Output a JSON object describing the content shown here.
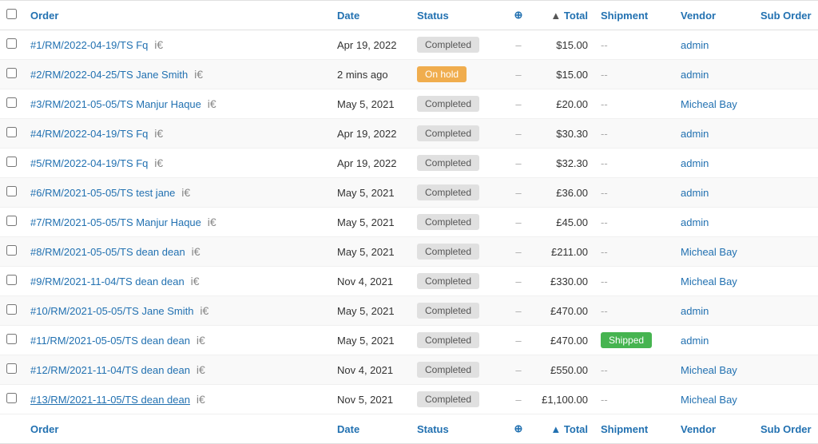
{
  "colors": {
    "link": "#2271b1",
    "completed_bg": "#e0e0e0",
    "completed_text": "#555",
    "onhold_bg": "#f0ad4e",
    "shipped_bg": "#46b450"
  },
  "header": {
    "columns": [
      {
        "id": "check",
        "label": ""
      },
      {
        "id": "order",
        "label": "Order",
        "sortable": true
      },
      {
        "id": "date",
        "label": "Date",
        "sortable": true
      },
      {
        "id": "status",
        "label": "Status",
        "sortable": false
      },
      {
        "id": "total_icon",
        "label": "⊕",
        "sortable": false
      },
      {
        "id": "total",
        "label": "Total",
        "sortable": true,
        "arrow": "▲"
      },
      {
        "id": "shipment",
        "label": "Shipment",
        "sortable": false
      },
      {
        "id": "vendor",
        "label": "Vendor",
        "sortable": false
      },
      {
        "id": "suborder",
        "label": "Sub Order",
        "sortable": false
      }
    ]
  },
  "rows": [
    {
      "id": 1,
      "order": "#1/RM/2022-04-19/TS Fq",
      "icon": "i€",
      "date": "Apr 19, 2022",
      "status": "Completed",
      "status_type": "completed",
      "total_dash": "–",
      "total": "$15.00",
      "shipment": "--",
      "vendor": "admin",
      "suborder": ""
    },
    {
      "id": 2,
      "order": "#2/RM/2022-04-25/TS Jane Smith",
      "icon": "i€",
      "date": "2 mins ago",
      "status": "On hold",
      "status_type": "onhold",
      "total_dash": "–",
      "total": "$15.00",
      "shipment": "--",
      "vendor": "admin",
      "suborder": ""
    },
    {
      "id": 3,
      "order": "#3/RM/2021-05-05/TS Manjur Haque",
      "icon": "i€",
      "date": "May 5, 2021",
      "status": "Completed",
      "status_type": "completed",
      "total_dash": "–",
      "total": "£20.00",
      "shipment": "--",
      "vendor": "Micheal Bay",
      "suborder": ""
    },
    {
      "id": 4,
      "order": "#4/RM/2022-04-19/TS Fq",
      "icon": "i€",
      "date": "Apr 19, 2022",
      "status": "Completed",
      "status_type": "completed",
      "total_dash": "–",
      "total": "$30.30",
      "shipment": "--",
      "vendor": "admin",
      "suborder": ""
    },
    {
      "id": 5,
      "order": "#5/RM/2022-04-19/TS Fq",
      "icon": "i€",
      "date": "Apr 19, 2022",
      "status": "Completed",
      "status_type": "completed",
      "total_dash": "–",
      "total": "$32.30",
      "shipment": "--",
      "vendor": "admin",
      "suborder": ""
    },
    {
      "id": 6,
      "order": "#6/RM/2021-05-05/TS test jane",
      "icon": "i€",
      "date": "May 5, 2021",
      "status": "Completed",
      "status_type": "completed",
      "total_dash": "–",
      "total": "£36.00",
      "shipment": "--",
      "vendor": "admin",
      "suborder": ""
    },
    {
      "id": 7,
      "order": "#7/RM/2021-05-05/TS Manjur Haque",
      "icon": "i€",
      "date": "May 5, 2021",
      "status": "Completed",
      "status_type": "completed",
      "total_dash": "–",
      "total": "£45.00",
      "shipment": "--",
      "vendor": "admin",
      "suborder": ""
    },
    {
      "id": 8,
      "order": "#8/RM/2021-05-05/TS dean dean",
      "icon": "i€",
      "date": "May 5, 2021",
      "status": "Completed",
      "status_type": "completed",
      "total_dash": "–",
      "total": "£211.00",
      "shipment": "--",
      "vendor": "Micheal Bay",
      "suborder": ""
    },
    {
      "id": 9,
      "order": "#9/RM/2021-11-04/TS dean dean",
      "icon": "i€",
      "date": "Nov 4, 2021",
      "status": "Completed",
      "status_type": "completed",
      "total_dash": "–",
      "total": "£330.00",
      "shipment": "--",
      "vendor": "Micheal Bay",
      "suborder": ""
    },
    {
      "id": 10,
      "order": "#10/RM/2021-05-05/TS Jane Smith",
      "icon": "i€",
      "date": "May 5, 2021",
      "status": "Completed",
      "status_type": "completed",
      "total_dash": "–",
      "total": "£470.00",
      "shipment": "--",
      "vendor": "admin",
      "suborder": ""
    },
    {
      "id": 11,
      "order": "#11/RM/2021-05-05/TS dean dean",
      "icon": "i€",
      "date": "May 5, 2021",
      "status": "Completed",
      "status_type": "completed",
      "total_dash": "–",
      "total": "£470.00",
      "shipment": "Shipped",
      "shipment_type": "shipped",
      "vendor": "admin",
      "suborder": ""
    },
    {
      "id": 12,
      "order": "#12/RM/2021-11-04/TS dean dean",
      "icon": "i€",
      "date": "Nov 4, 2021",
      "status": "Completed",
      "status_type": "completed",
      "total_dash": "–",
      "total": "£550.00",
      "shipment": "--",
      "vendor": "Micheal Bay",
      "suborder": ""
    },
    {
      "id": 13,
      "order": "#13/RM/2021-11-05/TS dean dean",
      "icon": "i€",
      "date": "Nov 5, 2021",
      "status": "Completed",
      "status_type": "completed",
      "total_dash": "–",
      "total": "£1,100.00",
      "shipment": "--",
      "vendor": "Micheal Bay",
      "suborder": "",
      "underlined": true
    }
  ],
  "footer": {
    "columns": [
      "",
      "Order",
      "Date",
      "Status",
      "⊕",
      "▲ Total",
      "Shipment",
      "Vendor",
      "Sub Order"
    ]
  }
}
